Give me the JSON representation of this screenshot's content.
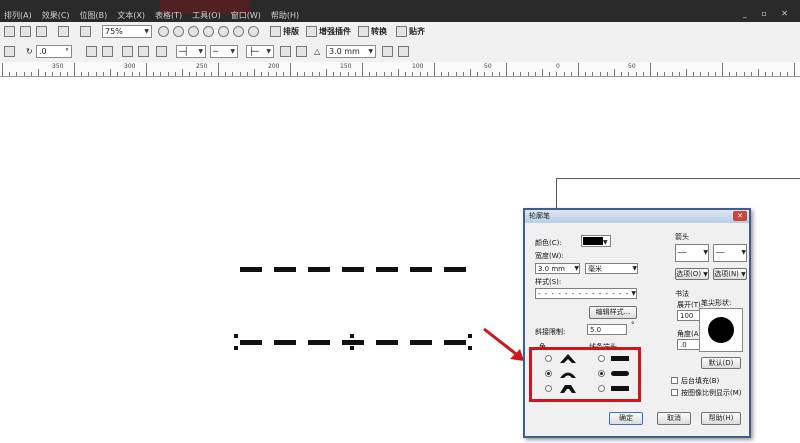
{
  "menu": {
    "items": [
      "排列(A)",
      "效果(C)",
      "位图(B)",
      "文本(X)",
      "表格(T)",
      "工具(O)",
      "窗口(W)",
      "帮助(H)"
    ]
  },
  "toolbar": {
    "zoom": "75%",
    "btn_typeset": "排版",
    "btn_plugin": "增强插件",
    "btn_convert": "转换",
    "btn_paste": "贴齐"
  },
  "propbar": {
    "rotation": ".0",
    "width": "3.0 mm"
  },
  "ruler": {
    "labels": [
      "350",
      "300",
      "250",
      "200",
      "150",
      "100",
      "50",
      "0",
      "50"
    ]
  },
  "dialog": {
    "title": "轮廓笔",
    "color_label": "颜色(C):",
    "width_label": "宽度(W):",
    "width_value": "3.0 mm",
    "unit_value": "毫米",
    "style_label": "样式(S):",
    "edit_style": "编辑样式...",
    "miter_label": "斜接限制:",
    "miter_value": "5.0",
    "corner_label": "角",
    "linecap_label": "线条端头",
    "arrows_label": "箭头",
    "options_left": "选项(O)",
    "options_right": "选项(N)",
    "calligraphy_label": "书法",
    "stretch_label": "展开(T):",
    "stretch_value": "100",
    "stretch_unit": "%",
    "nib_label": "笔尖形状:",
    "angle_label": "角度(A):",
    "angle_value": ".0",
    "default_btn": "默认(D)",
    "behind_fill": "后台填充(B)",
    "scale_with_image": "按图像比例显示(M)",
    "ok": "确定",
    "cancel": "取消",
    "help": "帮助(H)"
  },
  "colors": {
    "highlight": "#d0141c",
    "title_bar": "#2a2a2a"
  }
}
